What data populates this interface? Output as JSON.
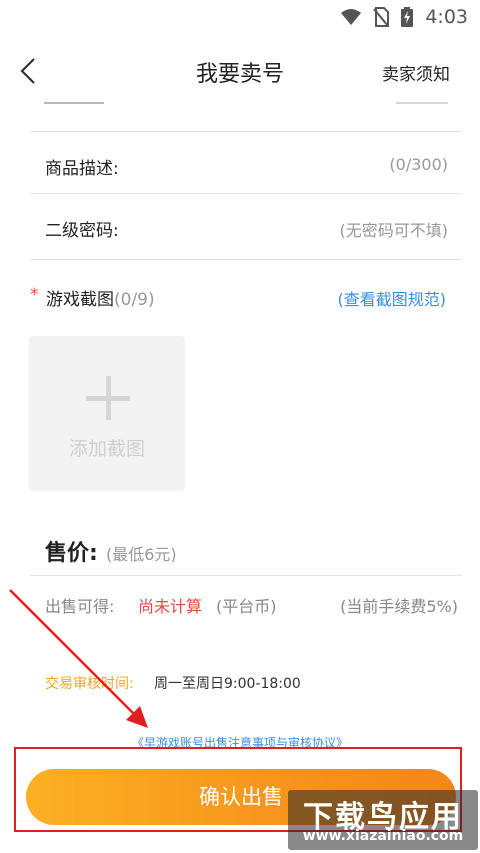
{
  "status_bar": {
    "time": "4:03",
    "icons": [
      "wifi-icon",
      "no-sim-icon",
      "battery-charging-icon"
    ]
  },
  "nav": {
    "back_icon": "chevron-left-icon",
    "title": "我要卖号",
    "notice": "卖家须知"
  },
  "form": {
    "description": {
      "label": "商品描述:",
      "hint": "(0/300)"
    },
    "secondary_password": {
      "label": "二级密码:",
      "hint": "(无密码可不填)"
    }
  },
  "screenshots": {
    "required_mark": "*",
    "label": "游戏截图",
    "count": "(0/9)",
    "spec_link": "(查看截图规范)",
    "add_label": "添加截图"
  },
  "price": {
    "label": "售价:",
    "hint": "(最低6元)",
    "proceeds_label": "出售可得:",
    "proceeds_value": "尚未计算",
    "proceeds_unit": "(平台币)",
    "fee_note": "(当前手续费5%)"
  },
  "review": {
    "label": "交易审核时间:",
    "value": "周一至周日9:00-18:00"
  },
  "agreement_link": "《早游戏账号出售注意事项与审核协议》",
  "confirm_button": "确认出售",
  "watermark": {
    "title": "下载鸟应用",
    "url": "www.xiazainiao.com"
  },
  "colors": {
    "accent_orange": "#f7941d",
    "required_red": "#e84a4a",
    "link_blue": "#3a8ee6",
    "review_label": "#f5a623",
    "annotation_red": "#e02020"
  }
}
